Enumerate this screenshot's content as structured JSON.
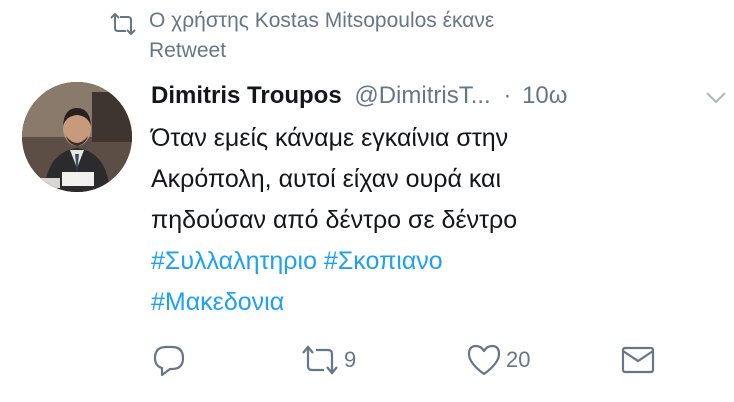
{
  "retweet_banner": {
    "icon": "retweet-icon",
    "text_line1": "Ο χρήστης Kostas Mitsopoulos έκανε",
    "text_line2": "Retweet"
  },
  "tweet": {
    "author_name": "Dimitris Troupos",
    "author_handle": "@DimitrisT...",
    "separator": "·",
    "timestamp": "10ω",
    "body_lines": [
      "Όταν εμείς κάναμε εγκαίνια στην",
      "Ακρόπολη, αυτοί  είχαν ουρά και",
      "πηδούσαν από δέντρο σε δέντρο"
    ],
    "hashtags": [
      "#Συλλαλητηριο",
      "#Σκοπιανο",
      "#Μακεδονια"
    ]
  },
  "actions": {
    "reply_count": "",
    "retweet_count": "9",
    "like_count": "20"
  },
  "colors": {
    "accent": "#1da1f2",
    "muted": "#657786",
    "text": "#14171a"
  }
}
